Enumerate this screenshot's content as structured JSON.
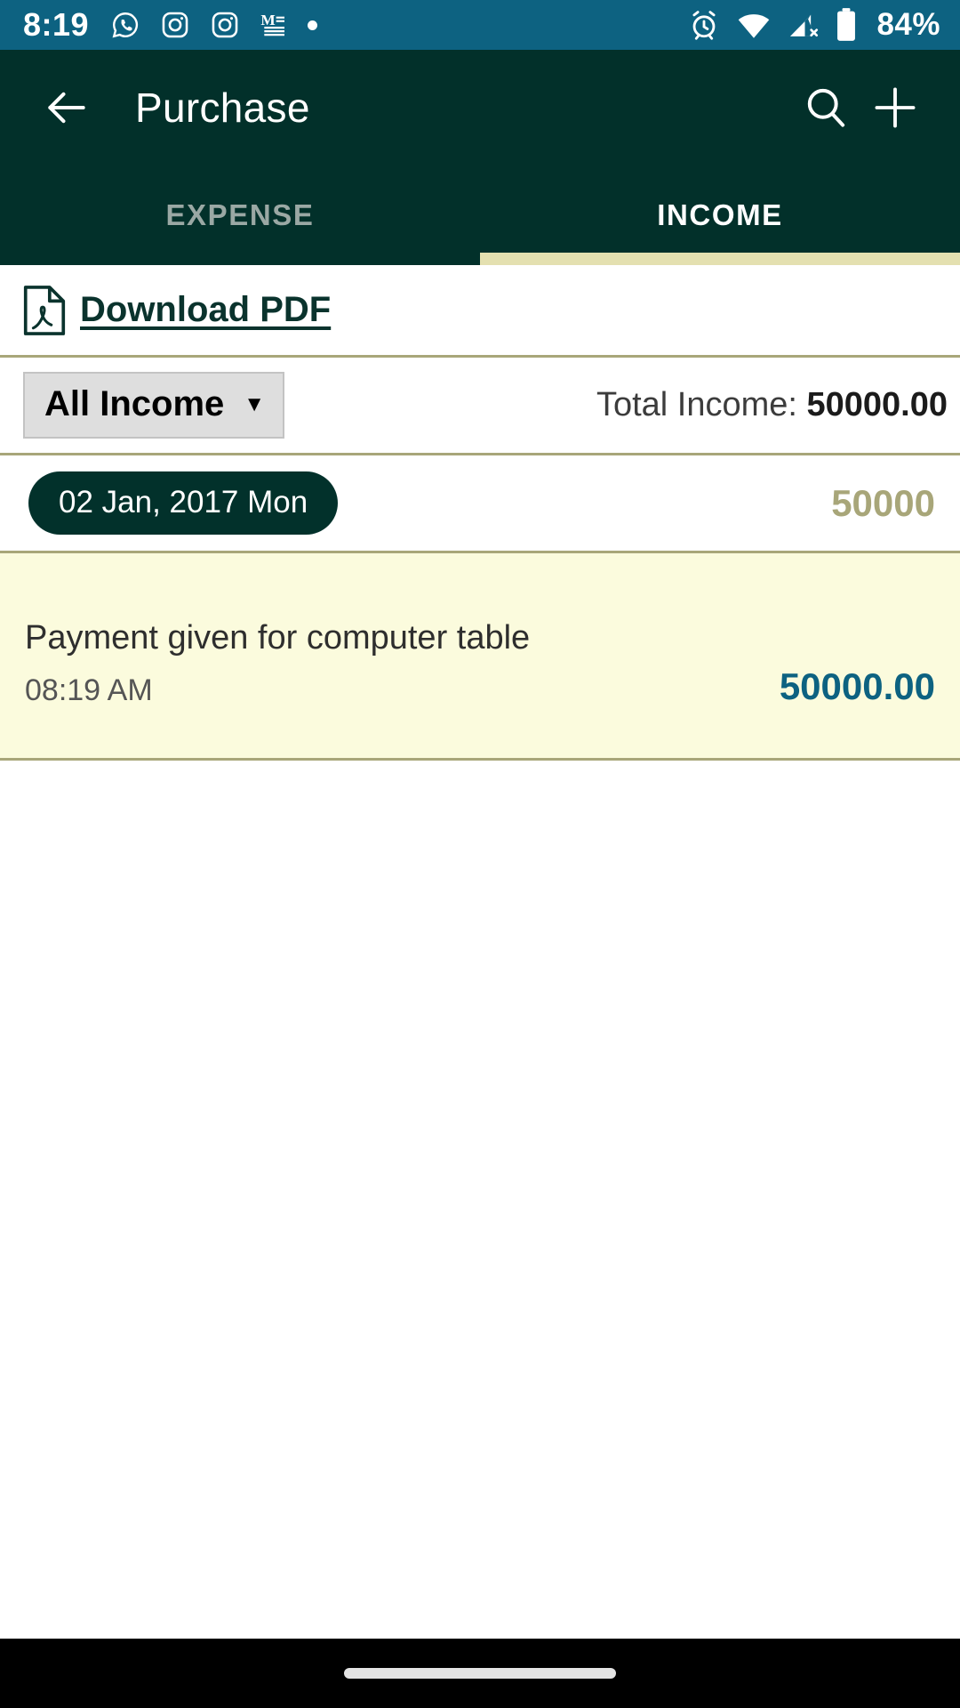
{
  "status_bar": {
    "time": "8:19",
    "battery_percent": "84%",
    "left_icons": [
      "whatsapp-icon",
      "instagram-icon",
      "instagram-icon",
      "medium-icon",
      "dot-icon"
    ],
    "right_icons": [
      "alarm-icon",
      "wifi-icon",
      "mobile-data-off-icon",
      "battery-icon"
    ],
    "background_color": "#0d6281"
  },
  "app_bar": {
    "title": "Purchase",
    "back_icon": "arrow-back-icon",
    "search_icon": "search-icon",
    "add_icon": "plus-icon",
    "background_color": "#02302a"
  },
  "tabs": {
    "items": [
      {
        "label": "EXPENSE",
        "active": false
      },
      {
        "label": "INCOME",
        "active": true
      }
    ],
    "indicator_color": "#e4e0b0"
  },
  "pdf": {
    "label": "Download PDF",
    "icon": "pdf-file-icon",
    "color": "#0a332d"
  },
  "filter": {
    "selected": "All Income",
    "caret": "▼",
    "total_label": "Total Income: ",
    "total_value": "50000.00"
  },
  "groups": [
    {
      "date": "02 Jan, 2017 Mon",
      "day_total": "50000",
      "day_total_color": "#a8a679",
      "transactions": [
        {
          "title": "Payment given for computer table",
          "time": "08:19 AM",
          "amount": "50000.00",
          "amount_color": "#0d6281",
          "background_color": "#fbfbdd"
        }
      ]
    }
  ],
  "nav_bar": {
    "gesture_pill": "home-indicator",
    "background_color": "#000000"
  }
}
